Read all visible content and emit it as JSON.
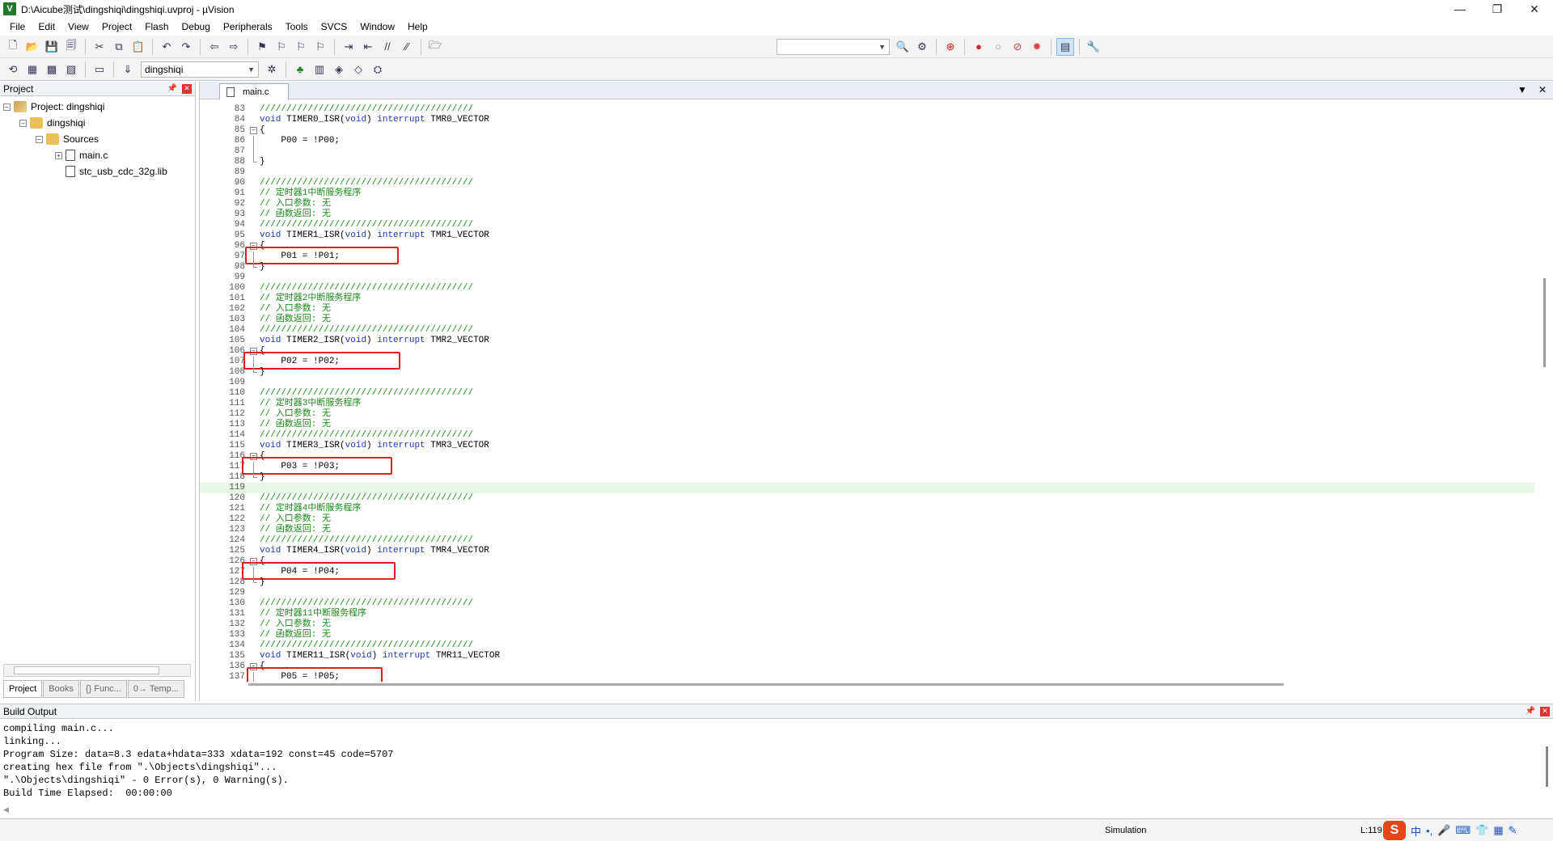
{
  "window": {
    "title": "D:\\Aicube测试\\dingshiqi\\dingshiqi.uvproj - µVision",
    "icon_letter": "V",
    "controls": {
      "minimize": "—",
      "restore": "❐",
      "close": "✕"
    }
  },
  "menu": [
    "File",
    "Edit",
    "View",
    "Project",
    "Flash",
    "Debug",
    "Peripherals",
    "Tools",
    "SVCS",
    "Window",
    "Help"
  ],
  "toolbar2": {
    "target": "dingshiqi"
  },
  "project_panel": {
    "title": "Project",
    "tree": {
      "root": "Project: dingshiqi",
      "target": "dingshiqi",
      "group": "Sources",
      "files": [
        "main.c",
        "stc_usb_cdc_32g.lib"
      ]
    },
    "tabs": [
      "Project",
      "Books",
      "{} Func...",
      "0→ Temp..."
    ]
  },
  "editor": {
    "tab": "main.c",
    "lines": [
      {
        "n": "83",
        "t": "////////////////////////////////////////"
      },
      {
        "n": "84",
        "t": "void TIMER0_ISR(void) interrupt TMR0_VECTOR"
      },
      {
        "n": "85",
        "t": "{"
      },
      {
        "n": "86",
        "t": "    P00 = !P00;"
      },
      {
        "n": "87",
        "t": ""
      },
      {
        "n": "88",
        "t": "}"
      },
      {
        "n": "89",
        "t": ""
      },
      {
        "n": "90",
        "t": "////////////////////////////////////////"
      },
      {
        "n": "91",
        "t": "// 定时器1中断服务程序"
      },
      {
        "n": "92",
        "t": "// 入口参数: 无"
      },
      {
        "n": "93",
        "t": "// 函数返回: 无"
      },
      {
        "n": "94",
        "t": "////////////////////////////////////////"
      },
      {
        "n": "95",
        "t": "void TIMER1_ISR(void) interrupt TMR1_VECTOR"
      },
      {
        "n": "96",
        "t": "{"
      },
      {
        "n": "97",
        "t": "    P01 = !P01;"
      },
      {
        "n": "98",
        "t": "}"
      },
      {
        "n": "99",
        "t": ""
      },
      {
        "n": "100",
        "t": "////////////////////////////////////////"
      },
      {
        "n": "101",
        "t": "// 定时器2中断服务程序"
      },
      {
        "n": "102",
        "t": "// 入口参数: 无"
      },
      {
        "n": "103",
        "t": "// 函数返回: 无"
      },
      {
        "n": "104",
        "t": "////////////////////////////////////////"
      },
      {
        "n": "105",
        "t": "void TIMER2_ISR(void) interrupt TMR2_VECTOR"
      },
      {
        "n": "106",
        "t": "{"
      },
      {
        "n": "107",
        "t": "    P02 = !P02;"
      },
      {
        "n": "108",
        "t": "}"
      },
      {
        "n": "109",
        "t": ""
      },
      {
        "n": "110",
        "t": "////////////////////////////////////////"
      },
      {
        "n": "111",
        "t": "// 定时器3中断服务程序"
      },
      {
        "n": "112",
        "t": "// 入口参数: 无"
      },
      {
        "n": "113",
        "t": "// 函数返回: 无"
      },
      {
        "n": "114",
        "t": "////////////////////////////////////////"
      },
      {
        "n": "115",
        "t": "void TIMER3_ISR(void) interrupt TMR3_VECTOR"
      },
      {
        "n": "116",
        "t": "{"
      },
      {
        "n": "117",
        "t": "    P03 = !P03;"
      },
      {
        "n": "118",
        "t": "}"
      },
      {
        "n": "119",
        "t": ""
      },
      {
        "n": "120",
        "t": "////////////////////////////////////////"
      },
      {
        "n": "121",
        "t": "// 定时器4中断服务程序"
      },
      {
        "n": "122",
        "t": "// 入口参数: 无"
      },
      {
        "n": "123",
        "t": "// 函数返回: 无"
      },
      {
        "n": "124",
        "t": "////////////////////////////////////////"
      },
      {
        "n": "125",
        "t": "void TIMER4_ISR(void) interrupt TMR4_VECTOR"
      },
      {
        "n": "126",
        "t": "{"
      },
      {
        "n": "127",
        "t": "    P04 = !P04;"
      },
      {
        "n": "128",
        "t": "}"
      },
      {
        "n": "129",
        "t": ""
      },
      {
        "n": "130",
        "t": "////////////////////////////////////////"
      },
      {
        "n": "131",
        "t": "// 定时器11中断服务程序"
      },
      {
        "n": "132",
        "t": "// 入口参数: 无"
      },
      {
        "n": "133",
        "t": "// 函数返回: 无"
      },
      {
        "n": "134",
        "t": "////////////////////////////////////////"
      },
      {
        "n": "135",
        "t": "void TIMER11_ISR(void) interrupt TMR11_VECTOR"
      },
      {
        "n": "136",
        "t": "{"
      },
      {
        "n": "137",
        "t": "    P05 = !P05;"
      }
    ],
    "current_line": "119"
  },
  "build_output": {
    "title": "Build Output",
    "lines": [
      "compiling main.c...",
      "linking...",
      "Program Size: data=8.3 edata+hdata=333 xdata=192 const=45 code=5707",
      "creating hex file from \".\\Objects\\dingshiqi\"...",
      "\".\\Objects\\dingshiqi\" - 0 Error(s), 0 Warning(s).",
      "Build Time Elapsed:  00:00:00"
    ]
  },
  "status": {
    "mode": "Simulation",
    "position": "L:119 C"
  },
  "tray": {
    "ime_logo": "S",
    "ime_lang": "中",
    "punct": "•,"
  }
}
